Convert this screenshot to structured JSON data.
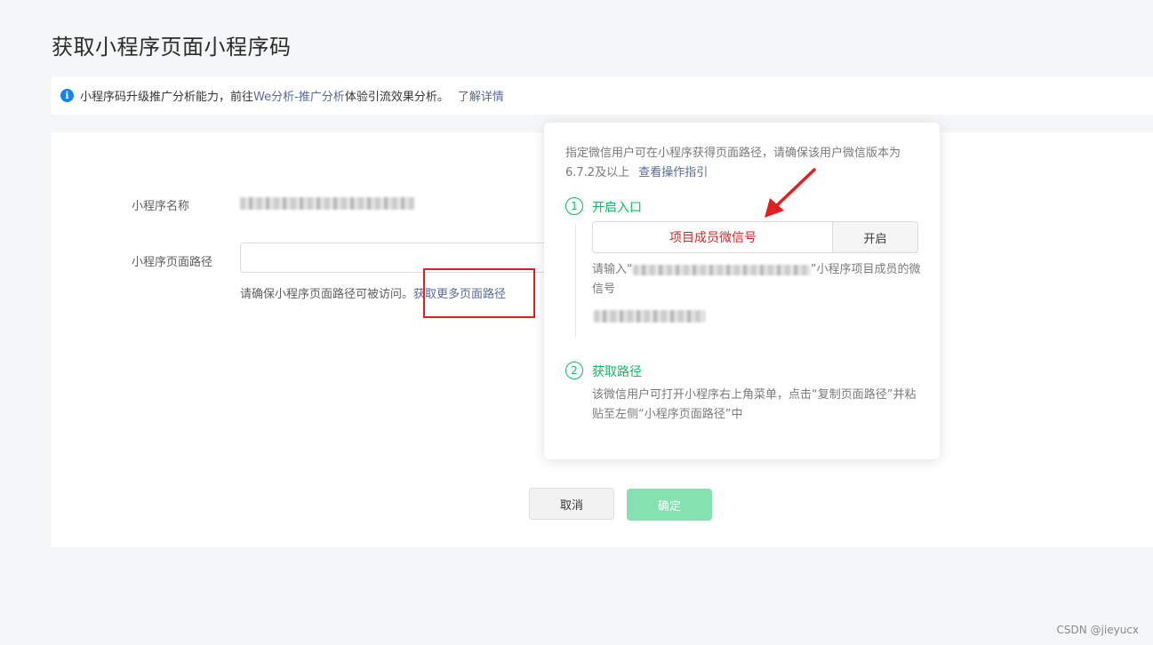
{
  "page": {
    "title": "获取小程序页面小程序码"
  },
  "notice": {
    "icon": "info-icon",
    "text_before": "小程序码升级推广分析能力，前往",
    "link_analysis": "We分析-推广分析",
    "text_after": "体验引流效果分析。",
    "link_details": "了解详情"
  },
  "form": {
    "name_label": "小程序名称",
    "path_label": "小程序页面路径",
    "path_value": "",
    "hint_text": "请确保小程序页面路径可被访问。",
    "hint_link": "获取更多页面路径"
  },
  "buttons": {
    "cancel": "取消",
    "confirm": "确定"
  },
  "popover": {
    "desc": "指定微信用户可在小程序获得页面路径，请确保该用户微信版本为6.7.2及以上",
    "guide_link": "查看操作指引",
    "step1": {
      "num": "1",
      "title": "开启入口",
      "input_annotation": "项目成员微信号",
      "open_button": "开启",
      "desc_before": "请输入“",
      "desc_after": "”小程序项目成员的微信号"
    },
    "step2": {
      "num": "2",
      "title": "获取路径",
      "desc": "该微信用户可打开小程序右上角菜单，点击“复制页面路径”并粘贴至左侧“小程序页面路径”中"
    }
  },
  "colors": {
    "accent_green": "#07c160",
    "link_blue": "#576b95",
    "info_blue": "#1485ee",
    "annotation_red": "#e02020",
    "confirm_disabled": "#86e1b0"
  },
  "watermark": "CSDN @jieyucx"
}
